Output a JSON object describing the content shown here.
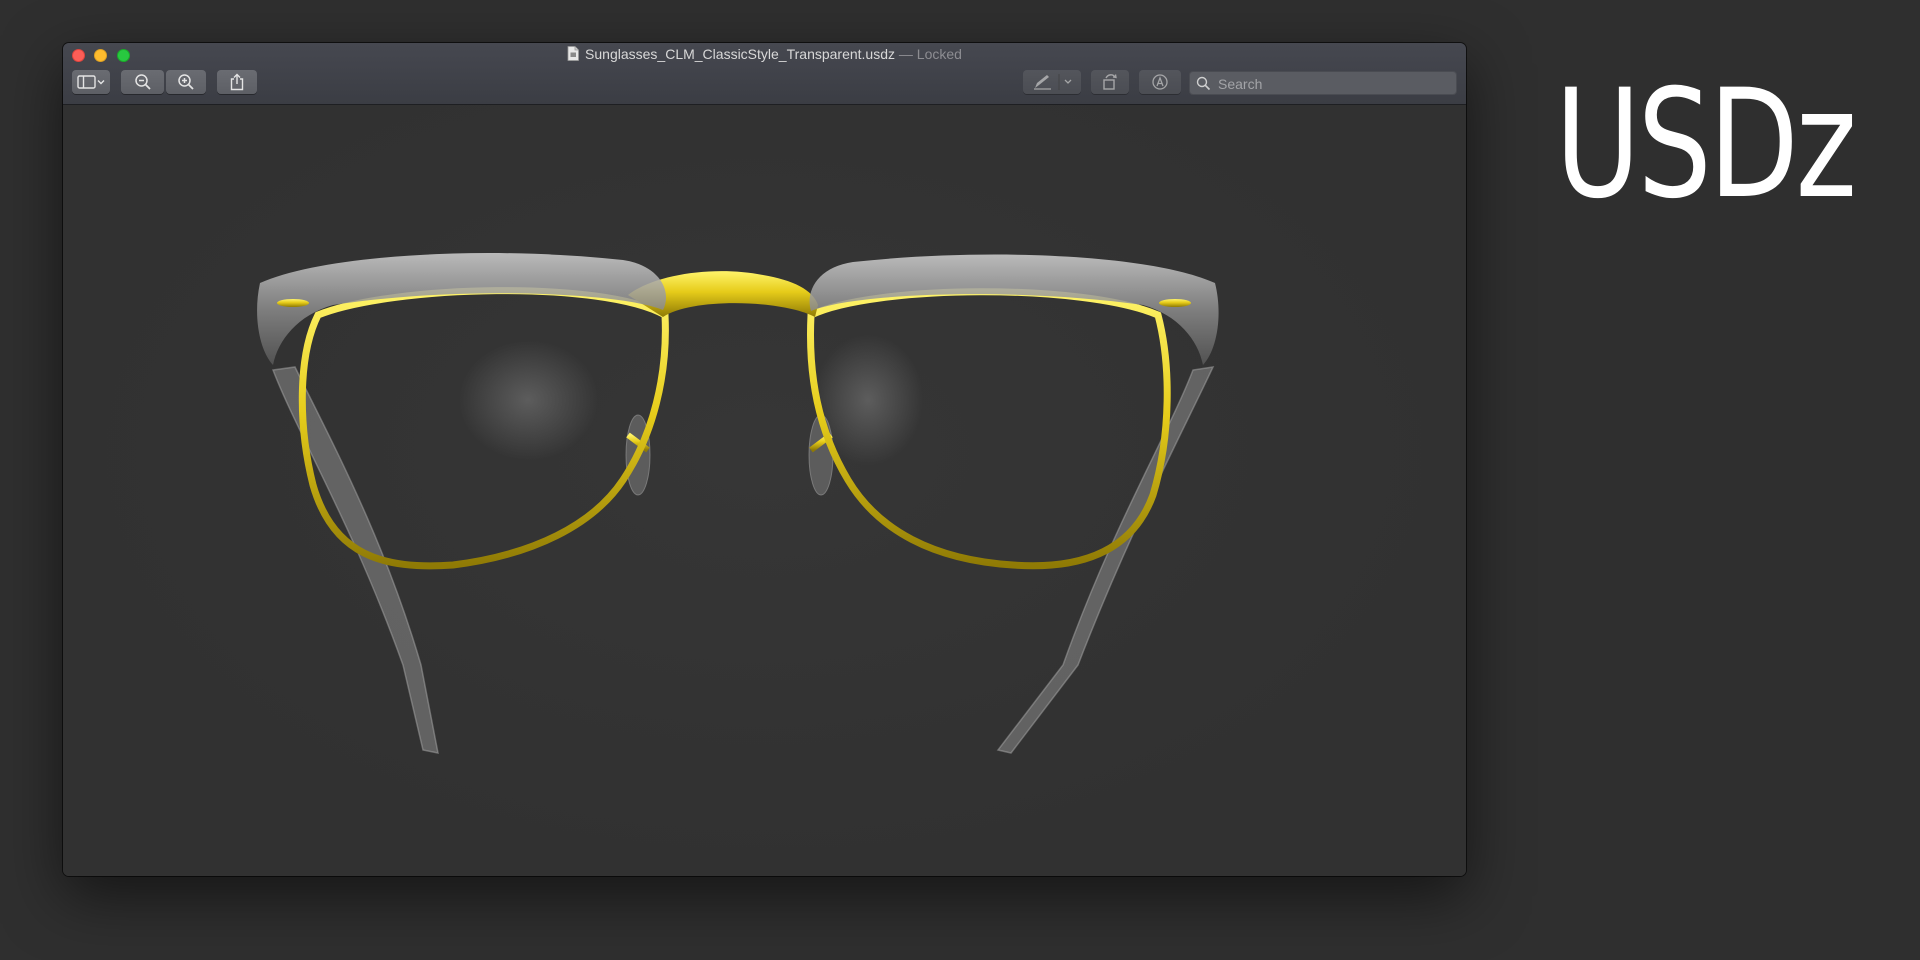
{
  "window": {
    "filename": "Sunglasses_CLM_ClassicStyle_Transparent.usdz",
    "status": " — Locked"
  },
  "toolbar": {
    "sidebar_button": "sidebar-toggle-icon",
    "zoom_out_button": "zoom-out-icon",
    "zoom_in_button": "zoom-in-icon",
    "share_button": "share-icon",
    "markup_button": "pen-icon",
    "rotate_button": "rotate-icon",
    "annotate_button": "markup-circle-icon"
  },
  "search": {
    "placeholder": "Search",
    "value": ""
  },
  "headline": "USDz",
  "colors": {
    "frame_gold": "#e6cc1a",
    "frame_gray": "#9a9a9a",
    "background": "#2f2f2f",
    "viewport": "#323232"
  }
}
